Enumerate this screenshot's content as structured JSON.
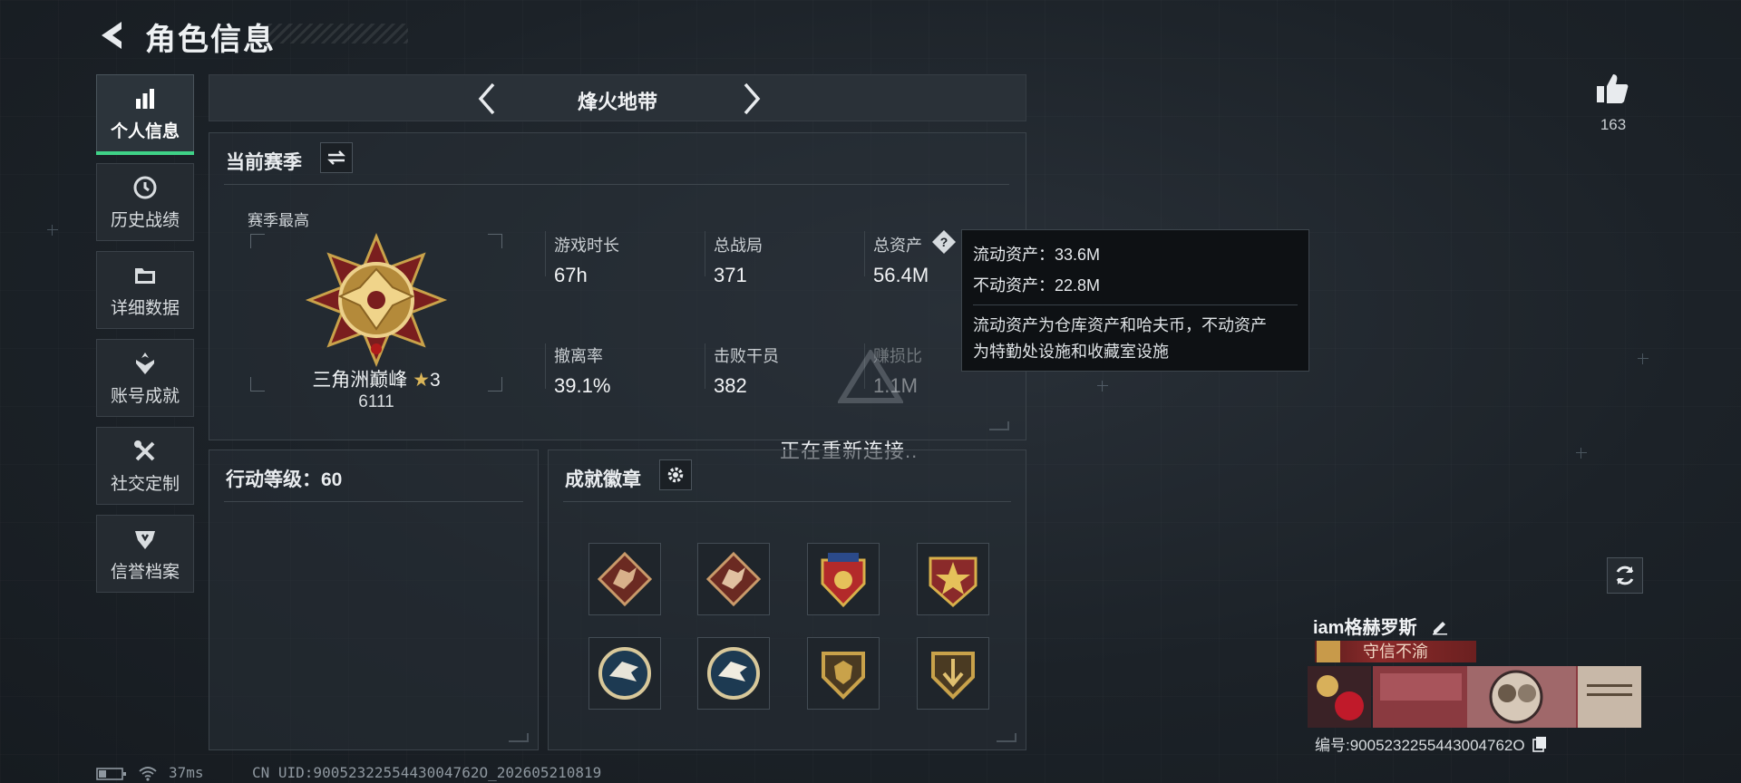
{
  "header": {
    "title": "角色信息"
  },
  "sidebar": {
    "items": [
      {
        "label": "个人信息",
        "icon": "bar-chart-icon",
        "active": true
      },
      {
        "label": "历史战绩",
        "icon": "history-clock-icon",
        "active": false
      },
      {
        "label": "详细数据",
        "icon": "folder-icon",
        "active": false
      },
      {
        "label": "账号成就",
        "icon": "achievement-icon",
        "active": false
      },
      {
        "label": "社交定制",
        "icon": "tools-icon",
        "active": false
      },
      {
        "label": "信誉档案",
        "icon": "shield-icon",
        "active": false
      }
    ]
  },
  "mode": {
    "title": "烽火地带"
  },
  "season": {
    "title": "当前赛季",
    "highest_label": "赛季最高",
    "rank_name": "三角洲巅峰",
    "rank_stars": "3",
    "rank_score": "6111",
    "stats": [
      {
        "label": "游戏时长",
        "value": "67h"
      },
      {
        "label": "总战局",
        "value": "371"
      },
      {
        "label": "总资产",
        "value": "56.4M"
      },
      {
        "label": "撤离率",
        "value": "39.1%"
      },
      {
        "label": "击败干员",
        "value": "382"
      },
      {
        "label": "赚损比",
        "value": "1.1M"
      }
    ]
  },
  "tooltip": {
    "liquid": "流动资产：33.6M",
    "fixed": "不动资产：22.8M",
    "desc_line1": "流动资产为仓库资产和哈夫币，不动资产",
    "desc_line2": "为特勤处设施和收藏室设施"
  },
  "overlay": {
    "reconnecting": "正在重新连接.."
  },
  "action_level": {
    "title": "行动等级：60"
  },
  "achievements": {
    "title": "成就徽章",
    "badges": [
      {
        "icon": "dragon-diamond-badge-icon"
      },
      {
        "icon": "dragon-diamond-badge-icon"
      },
      {
        "icon": "red-shield-stars-badge-icon"
      },
      {
        "icon": "star-medal-badge-icon"
      },
      {
        "icon": "eagle-circle-badge-icon"
      },
      {
        "icon": "eagle-circle-badge-icon"
      },
      {
        "icon": "gold-shield-badge-icon"
      },
      {
        "icon": "gold-shield-arrow-badge-icon"
      }
    ]
  },
  "profile": {
    "like_count": "163",
    "player_name": "iam格赫罗斯",
    "honor_title": "守信不渝",
    "uid_label": "编号:9005232255443004762O"
  },
  "status_bar": {
    "ping": "37ms",
    "uid_text": "CN UID:9005232255443004762O_202605210819"
  },
  "colors": {
    "accent_green": "#3fd287",
    "honor_red": "#8b2a2a",
    "tooltip_bg": "#0e1114"
  }
}
